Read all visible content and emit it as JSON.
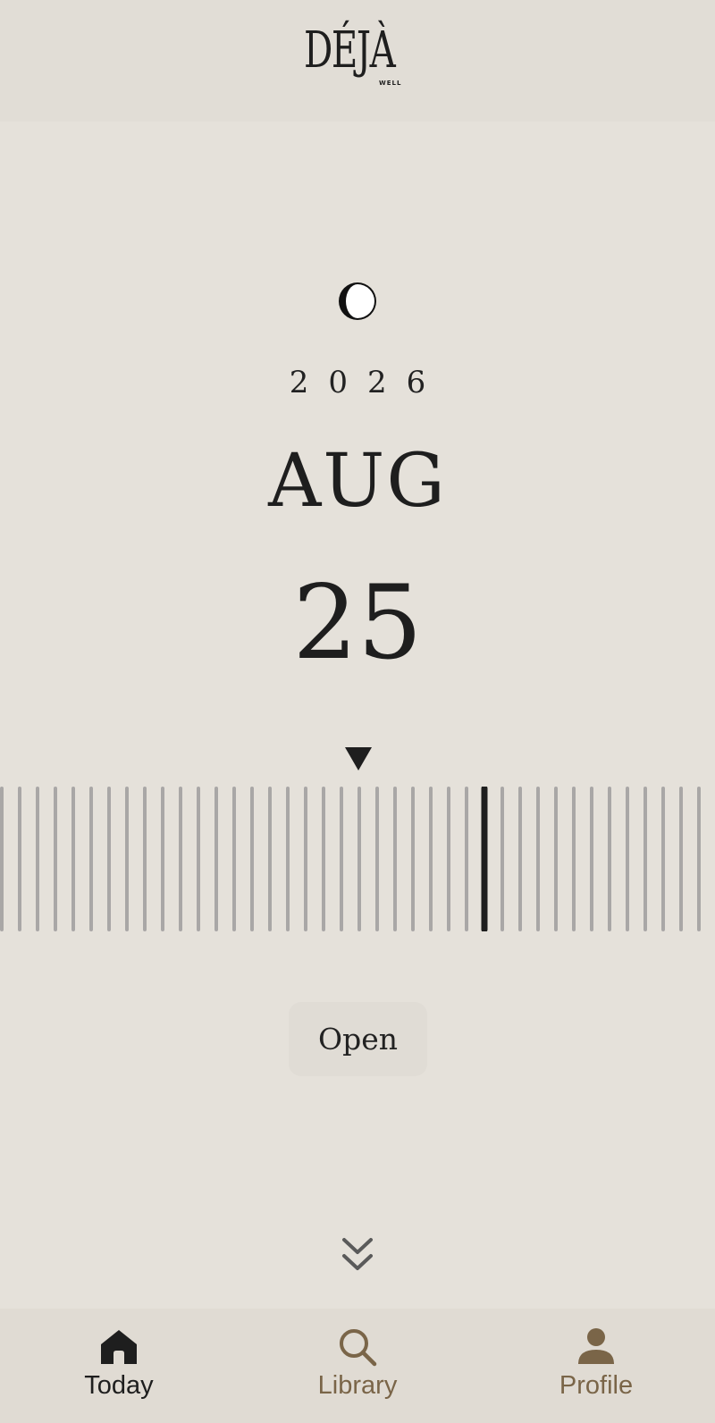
{
  "brand": {
    "name": "DÉJÀ",
    "subtitle": "WELL"
  },
  "date": {
    "moon_icon": "first-quarter-moon-icon",
    "year": "2026",
    "month": "AUG",
    "day": "25"
  },
  "picker": {
    "pointer_icon": "triangle-down-icon",
    "selected_tick_index": 27,
    "tick_count": 41
  },
  "actions": {
    "open_label": "Open"
  },
  "scroll_hint_icon": "double-chevron-down-icon",
  "tabs": [
    {
      "label": "Today",
      "icon": "home-icon",
      "active": true
    },
    {
      "label": "Library",
      "icon": "search-icon",
      "active": false
    },
    {
      "label": "Profile",
      "icon": "person-icon",
      "active": false
    }
  ],
  "colors": {
    "background": "#e5e1da",
    "header_background": "#e1ddd6",
    "text": "#1e1e1e",
    "tick": "#a9a7a6",
    "tick_selected": "#1e1e1e",
    "tab_inactive": "#7a6548"
  }
}
